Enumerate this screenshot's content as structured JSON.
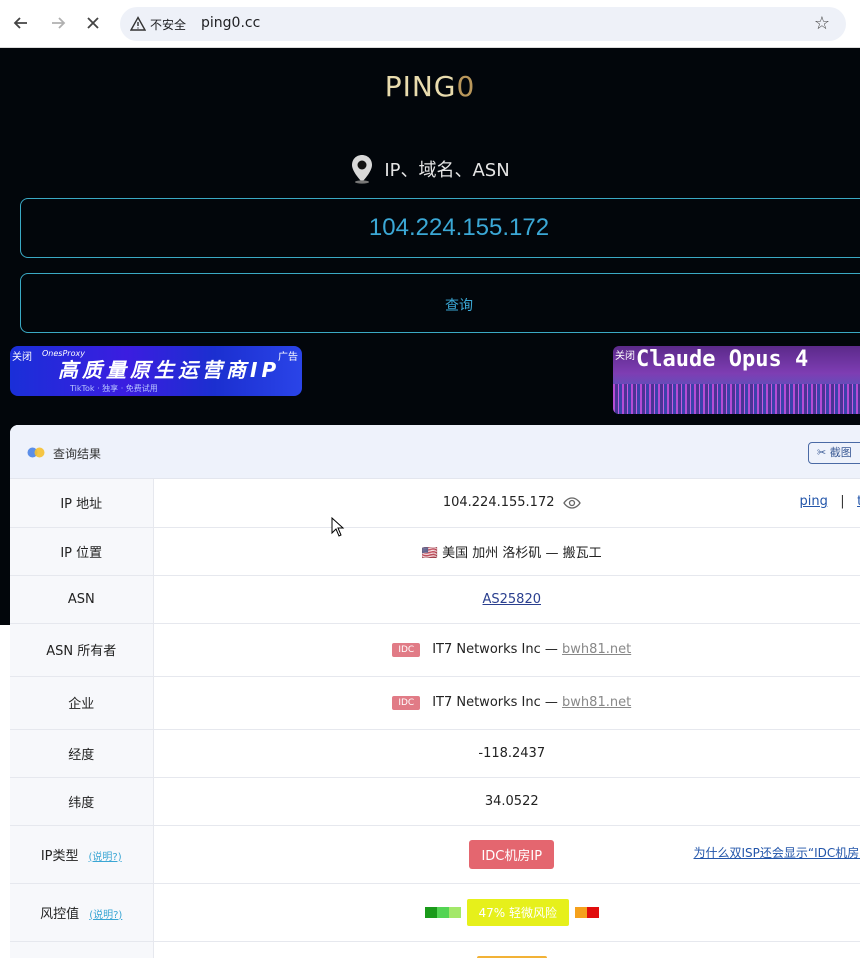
{
  "browser": {
    "security_label": "不安全",
    "url": "ping0.cc"
  },
  "page": {
    "logo_main": "PING",
    "logo_zero": "0",
    "hint": "IP、域名、ASN",
    "input_value": "104.224.155.172",
    "query_button": "查询"
  },
  "ads": {
    "left": {
      "close": "关闭",
      "brand": "OnesProxy",
      "tag": "广告",
      "headline": "高质量原生运营商IP",
      "subline": "TikTok  ·  独享  ·  免费试用"
    },
    "right": {
      "close": "关闭",
      "headline": "Claude Opus 4"
    }
  },
  "result": {
    "title": "查询结果",
    "screenshot_button": "截图",
    "rows": {
      "ip_label": "IP 地址",
      "ip_value": "104.224.155.172",
      "ping_link": "ping",
      "separator": "|",
      "trace_link": "tr",
      "location_label": "IP 位置",
      "location_value": "🇺🇸 美国 加州 洛杉矶 — 搬瓦工",
      "asn_label": "ASN",
      "asn_value": "AS25820",
      "asn_owner_label": "ASN 所有者",
      "asn_owner_badge": "IDC",
      "asn_owner_value": "IT7 Networks Inc — ",
      "asn_owner_domain": "bwh81.net",
      "org_label": "企业",
      "org_badge": "IDC",
      "org_value": "IT7 Networks Inc — ",
      "org_domain": "bwh81.net",
      "lon_label": "经度",
      "lon_value": "-118.2437",
      "lat_label": "纬度",
      "lat_value": "34.0522",
      "iptype_label": "IP类型",
      "iptype_help": "(说明?)",
      "iptype_value": "IDC机房IP",
      "iptype_side_link": "为什么双ISP还会显示“IDC机房IP",
      "risk_label": "风控值",
      "risk_help": "(说明?)",
      "risk_value": "47%  轻微风险"
    }
  },
  "colors": {
    "accent": "#3ba8d6",
    "idc_red": "#e4666f",
    "risk_yellow": "#e6f01b"
  }
}
